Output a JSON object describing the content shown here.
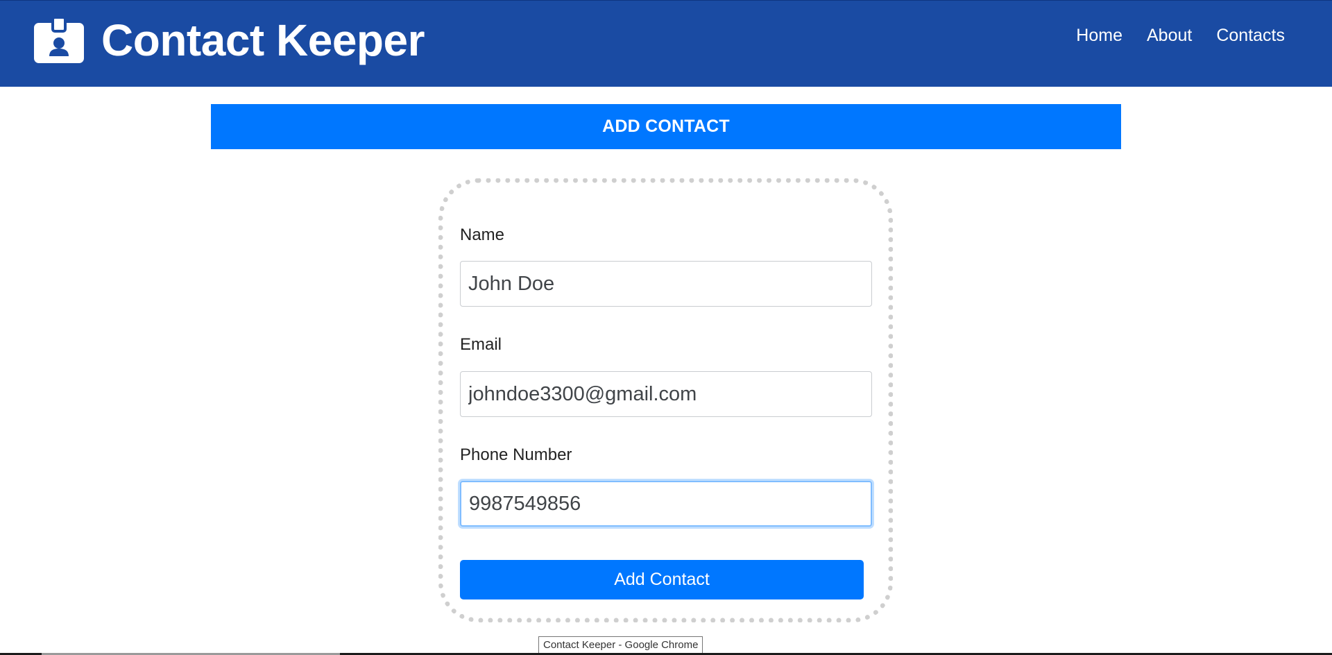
{
  "app": {
    "title": "Contact Keeper",
    "icon": "id-badge-icon"
  },
  "nav": {
    "items": [
      {
        "label": "Home"
      },
      {
        "label": "About"
      },
      {
        "label": "Contacts"
      }
    ]
  },
  "banner": {
    "label": "ADD CONTACT"
  },
  "form": {
    "name_label": "Name",
    "name_value": "John Doe",
    "email_label": "Email",
    "email_value": "johndoe3300@gmail.com",
    "phone_label": "Phone Number",
    "phone_value": "9987549856",
    "submit_label": "Add Contact"
  },
  "tooltip": {
    "text": "Contact Keeper - Google Chrome"
  },
  "colors": {
    "navbar": "#1a4ba3",
    "accent": "#0077ff",
    "card_border": "#cfcfcf"
  }
}
